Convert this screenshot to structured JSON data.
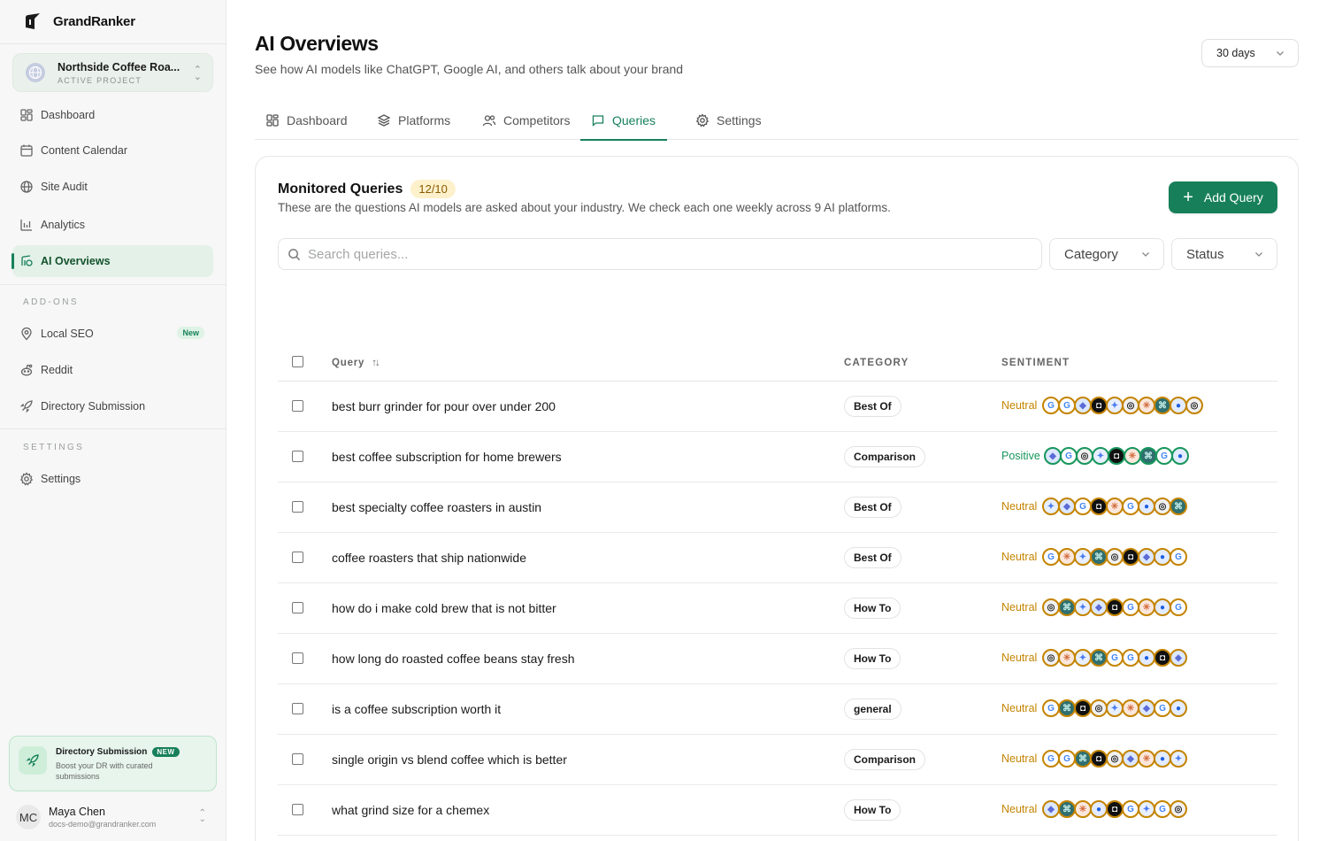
{
  "app": {
    "name": "GrandRanker"
  },
  "project": {
    "name": "Northside Coffee Roa...",
    "label": "ACTIVE PROJECT"
  },
  "sidebar": {
    "items": [
      {
        "label": "Dashboard",
        "icon": "grid-icon"
      },
      {
        "label": "Content Calendar",
        "icon": "calendar-icon"
      },
      {
        "label": "Site Audit",
        "icon": "globe-icon"
      },
      {
        "label": "Analytics",
        "icon": "bar-chart-icon"
      },
      {
        "label": "AI Overviews",
        "icon": "ai-icon",
        "active": true
      }
    ],
    "addons_label": "ADD-ONS",
    "addons": [
      {
        "label": "Local SEO",
        "icon": "map-pin-icon",
        "badge": "New"
      },
      {
        "label": "Reddit",
        "icon": "reddit-icon"
      },
      {
        "label": "Directory Submission",
        "icon": "rocket-icon"
      }
    ],
    "settings_label": "SETTINGS",
    "settings": [
      {
        "label": "Settings",
        "icon": "gear-icon"
      }
    ]
  },
  "promo": {
    "title": "Directory Submission",
    "tag": "NEW",
    "desc": "Boost your DR with curated submissions"
  },
  "user": {
    "initials": "MC",
    "name": "Maya Chen",
    "email": "docs-demo@grandranker.com"
  },
  "header": {
    "title": "AI Overviews",
    "subtitle": "See how AI models like ChatGPT, Google AI, and others talk about your brand",
    "range": "30 days"
  },
  "tabs": [
    {
      "label": "Dashboard",
      "icon": "grid-icon"
    },
    {
      "label": "Platforms",
      "icon": "layers-icon"
    },
    {
      "label": "Competitors",
      "icon": "users-icon"
    },
    {
      "label": "Queries",
      "icon": "message-icon",
      "active": true
    },
    {
      "label": "Settings",
      "icon": "gear-icon"
    }
  ],
  "card": {
    "title": "Monitored Queries",
    "count": "12/10",
    "desc": "These are the questions AI models are asked about your industry. We check each one weekly across 9 AI platforms.",
    "add_label": "Add Query",
    "search_placeholder": "Search queries...",
    "category_filter": "Category",
    "status_filter": "Status"
  },
  "table": {
    "columns": {
      "query": "Query",
      "category": "CATEGORY",
      "sentiment": "SENTIMENT"
    },
    "rows": [
      {
        "query": "best burr grinder for pour over under 200",
        "category": "Best Of",
        "sentiment": "Neutral",
        "platforms": [
          "google",
          "google",
          "copilot",
          "grok",
          "gemini",
          "openai",
          "claude",
          "perplexity",
          "meta",
          "openai"
        ]
      },
      {
        "query": "best coffee subscription for home brewers",
        "category": "Comparison",
        "sentiment": "Positive",
        "platforms": [
          "copilot",
          "google",
          "openai",
          "gemini",
          "grok",
          "claude",
          "perplexity",
          "google",
          "meta"
        ]
      },
      {
        "query": "best specialty coffee roasters in austin",
        "category": "Best Of",
        "sentiment": "Neutral",
        "platforms": [
          "gemini",
          "copilot",
          "google",
          "grok",
          "claude",
          "google",
          "meta",
          "openai",
          "perplexity"
        ]
      },
      {
        "query": "coffee roasters that ship nationwide",
        "category": "Best Of",
        "sentiment": "Neutral",
        "platforms": [
          "google",
          "claude",
          "gemini",
          "perplexity",
          "openai",
          "grok",
          "copilot",
          "meta",
          "google"
        ]
      },
      {
        "query": "how do i make cold brew that is not bitter",
        "category": "How To",
        "sentiment": "Neutral",
        "platforms": [
          "openai",
          "perplexity",
          "gemini",
          "copilot",
          "grok",
          "google",
          "claude",
          "meta",
          "google"
        ]
      },
      {
        "query": "how long do roasted coffee beans stay fresh",
        "category": "How To",
        "sentiment": "Neutral",
        "platforms": [
          "openai",
          "claude",
          "gemini",
          "perplexity",
          "google",
          "google",
          "meta",
          "grok",
          "copilot"
        ]
      },
      {
        "query": "is a coffee subscription worth it",
        "category": "general",
        "sentiment": "Neutral",
        "platforms": [
          "google",
          "perplexity",
          "grok",
          "openai",
          "gemini",
          "claude",
          "copilot",
          "google",
          "meta"
        ]
      },
      {
        "query": "single origin vs blend coffee which is better",
        "category": "Comparison",
        "sentiment": "Neutral",
        "platforms": [
          "google",
          "google",
          "perplexity",
          "grok",
          "openai",
          "copilot",
          "claude",
          "meta",
          "gemini"
        ]
      },
      {
        "query": "what grind size for a chemex",
        "category": "How To",
        "sentiment": "Neutral",
        "platforms": [
          "copilot",
          "perplexity",
          "claude",
          "meta",
          "grok",
          "google",
          "gemini",
          "google",
          "openai"
        ]
      }
    ]
  },
  "colors": {
    "accent": "#17805a",
    "neutral": "#c48400",
    "positive": "#17965c",
    "pill": "#fdf1cc"
  }
}
